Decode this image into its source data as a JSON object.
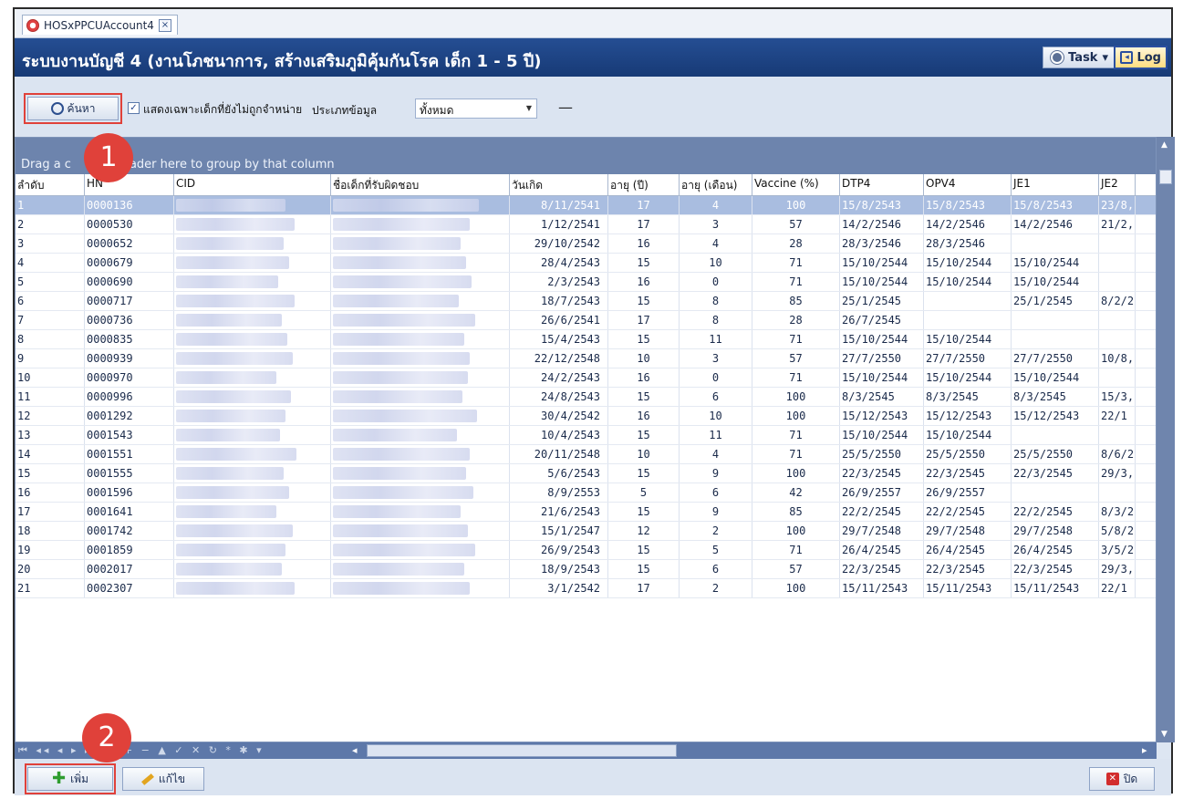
{
  "window": {
    "tab_title": "HOSxPPCUAccount4",
    "tab_close": "×",
    "title": "ระบบงานบัญชี 4 (งานโภชนาการ, สร้างเสริมภูมิคุ้มกันโรค เด็ก 1 - 5 ปี)",
    "task_label": "Task",
    "log_label": "Log"
  },
  "toolbar": {
    "search_label": "ค้นหา",
    "only_undischarged_label": "แสดงเฉพาะเด็กที่ยังไม่ถูกจำหน่าย",
    "only_undischarged_checked": true,
    "data_type_label": "ประเภทข้อมูล",
    "data_type_value": "ทั้งหมด"
  },
  "grid": {
    "group_hint": "Drag a column header here to group by that column",
    "group_hint_visible": "Drag a c",
    "group_hint_tail": "eader here to group by that column",
    "columns": [
      "ลำดับ",
      "HN",
      "CID",
      "ชื่อเด็กที่รับผิดชอบ",
      "วันเกิด",
      "อายุ (ปี)",
      "อายุ (เดือน)",
      "Vaccine (%)",
      "DTP4",
      "OPV4",
      "JE1",
      "JE2"
    ],
    "rows": [
      [
        "1",
        "0000136",
        "8/11/2541",
        "17",
        "4",
        "100",
        "15/8/2543",
        "15/8/2543",
        "15/8/2543",
        "23/8,"
      ],
      [
        "2",
        "0000530",
        "1/12/2541",
        "17",
        "3",
        "57",
        "14/2/2546",
        "14/2/2546",
        "14/2/2546",
        "21/2,"
      ],
      [
        "3",
        "0000652",
        "29/10/2542",
        "16",
        "4",
        "28",
        "28/3/2546",
        "28/3/2546",
        "",
        ""
      ],
      [
        "4",
        "0000679",
        "28/4/2543",
        "15",
        "10",
        "71",
        "15/10/2544",
        "15/10/2544",
        "15/10/2544",
        ""
      ],
      [
        "5",
        "0000690",
        "2/3/2543",
        "16",
        "0",
        "71",
        "15/10/2544",
        "15/10/2544",
        "15/10/2544",
        ""
      ],
      [
        "6",
        "0000717",
        "18/7/2543",
        "15",
        "8",
        "85",
        "25/1/2545",
        "",
        "25/1/2545",
        "8/2/2"
      ],
      [
        "7",
        "0000736",
        "26/6/2541",
        "17",
        "8",
        "28",
        "26/7/2545",
        "",
        "",
        ""
      ],
      [
        "8",
        "0000835",
        "15/4/2543",
        "15",
        "11",
        "71",
        "15/10/2544",
        "15/10/2544",
        "",
        ""
      ],
      [
        "9",
        "0000939",
        "22/12/2548",
        "10",
        "3",
        "57",
        "27/7/2550",
        "27/7/2550",
        "27/7/2550",
        "10/8,"
      ],
      [
        "10",
        "0000970",
        "24/2/2543",
        "16",
        "0",
        "71",
        "15/10/2544",
        "15/10/2544",
        "15/10/2544",
        ""
      ],
      [
        "11",
        "0000996",
        "24/8/2543",
        "15",
        "6",
        "100",
        "8/3/2545",
        "8/3/2545",
        "8/3/2545",
        "15/3,"
      ],
      [
        "12",
        "0001292",
        "30/4/2542",
        "16",
        "10",
        "100",
        "15/12/2543",
        "15/12/2543",
        "15/12/2543",
        "22/1"
      ],
      [
        "13",
        "0001543",
        "10/4/2543",
        "15",
        "11",
        "71",
        "15/10/2544",
        "15/10/2544",
        "",
        ""
      ],
      [
        "14",
        "0001551",
        "20/11/2548",
        "10",
        "4",
        "71",
        "25/5/2550",
        "25/5/2550",
        "25/5/2550",
        "8/6/2"
      ],
      [
        "15",
        "0001555",
        "5/6/2543",
        "15",
        "9",
        "100",
        "22/3/2545",
        "22/3/2545",
        "22/3/2545",
        "29/3,"
      ],
      [
        "16",
        "0001596",
        "8/9/2553",
        "5",
        "6",
        "42",
        "26/9/2557",
        "26/9/2557",
        "",
        ""
      ],
      [
        "17",
        "0001641",
        "21/6/2543",
        "15",
        "9",
        "85",
        "22/2/2545",
        "22/2/2545",
        "22/2/2545",
        "8/3/2"
      ],
      [
        "18",
        "0001742",
        "15/1/2547",
        "12",
        "2",
        "100",
        "29/7/2548",
        "29/7/2548",
        "29/7/2548",
        "5/8/2"
      ],
      [
        "19",
        "0001859",
        "26/9/2543",
        "15",
        "5",
        "71",
        "26/4/2545",
        "26/4/2545",
        "26/4/2545",
        "3/5/2"
      ],
      [
        "20",
        "0002017",
        "18/9/2543",
        "15",
        "6",
        "57",
        "22/3/2545",
        "22/3/2545",
        "22/3/2545",
        "29/3,"
      ],
      [
        "21",
        "0002307",
        "3/1/2542",
        "17",
        "2",
        "100",
        "15/11/2543",
        "15/11/2543",
        "15/11/2543",
        "22/1"
      ]
    ],
    "partial_row_cid": "1000001365400"
  },
  "footer": {
    "add_label": "เพิ่ม",
    "edit_label": "แก้ไข",
    "close_label": "ปิด"
  },
  "annotations": {
    "badge1": "1",
    "badge2": "2",
    "highlight_color": "#e0413a"
  }
}
